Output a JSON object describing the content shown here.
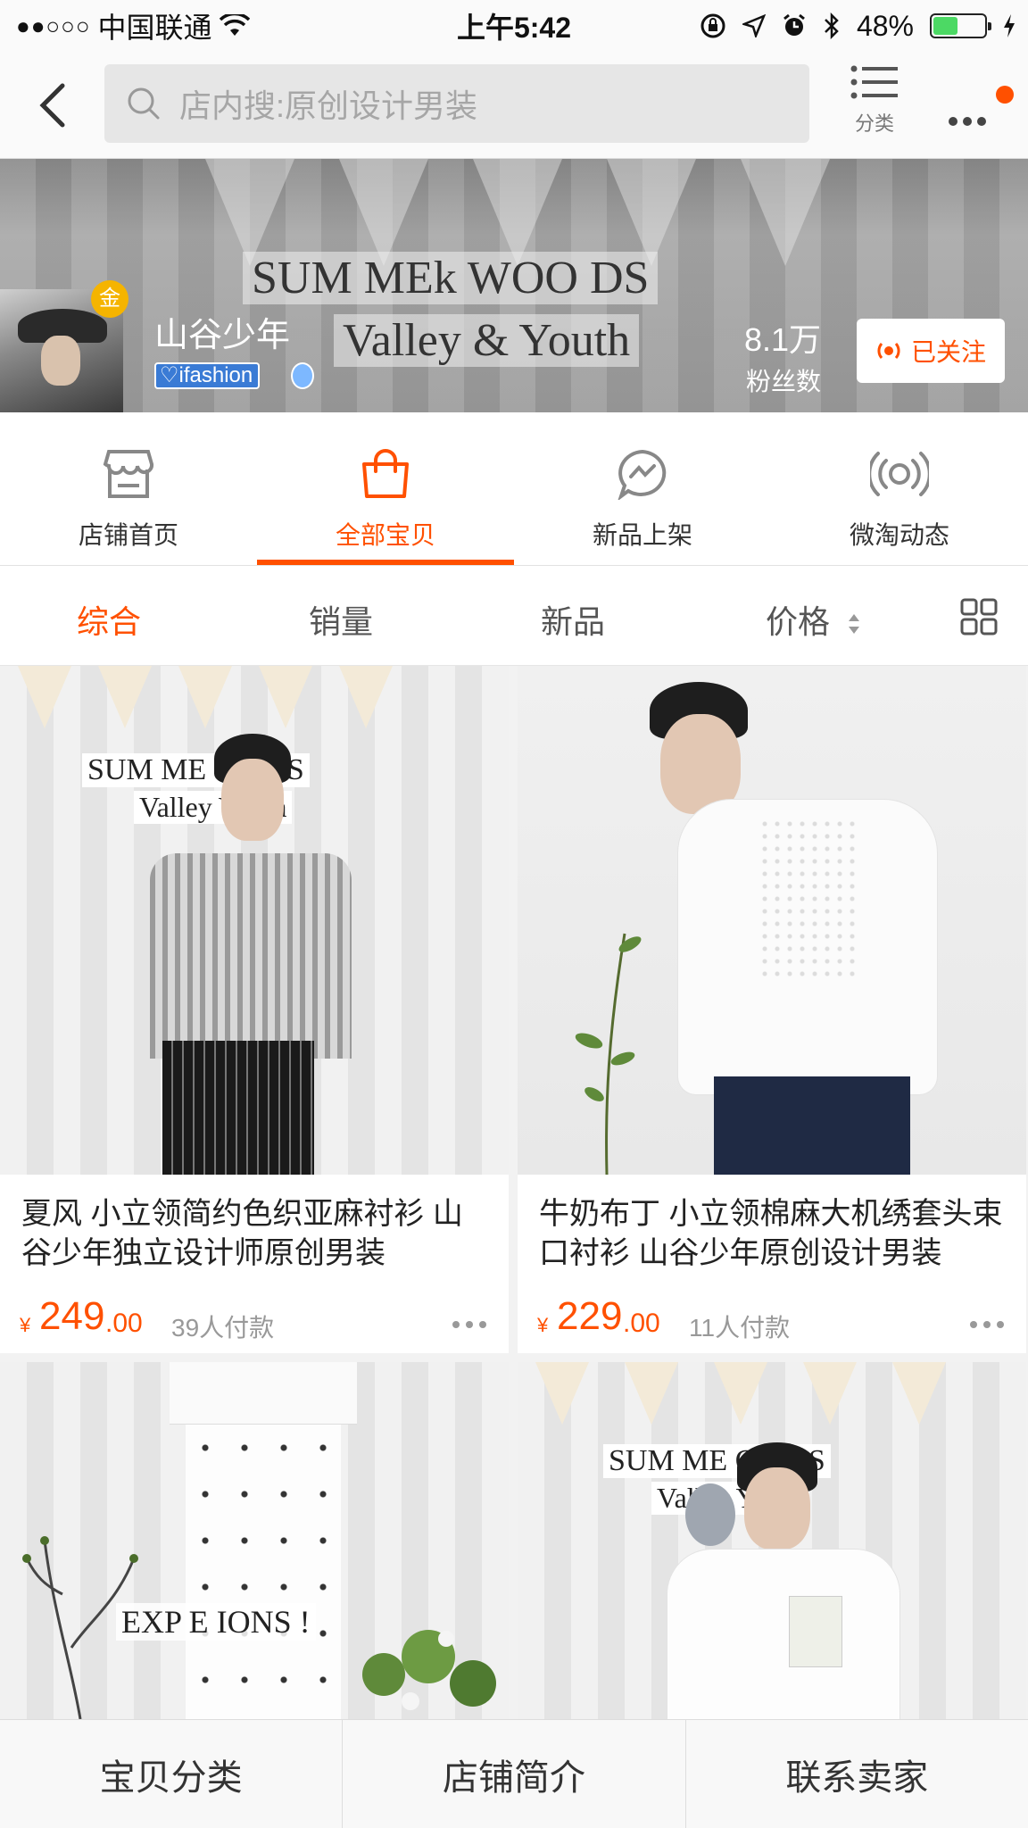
{
  "status_bar": {
    "signal": "●●○○○",
    "carrier": "中国联通",
    "time": "上午5:42",
    "battery": "48%",
    "battery_level": 0.48
  },
  "nav": {
    "search_placeholder": "店内搜:原创设计男装",
    "category_label": "分类"
  },
  "shop": {
    "name": "山谷少年",
    "gold_badge": "金",
    "ifashion_label": "ifashion",
    "fans_count": "8.1万",
    "fans_label": "粉丝数",
    "follow_label": "已关注",
    "banner_line1": "SUM MEk WOO DS",
    "banner_line2": "Valley & Youth"
  },
  "shop_tabs": [
    {
      "label": "店铺首页",
      "icon": "store-icon",
      "active": false
    },
    {
      "label": "全部宝贝",
      "icon": "bag-icon",
      "active": true
    },
    {
      "label": "新品上架",
      "icon": "new-arrival-icon",
      "active": false
    },
    {
      "label": "微淘动态",
      "icon": "broadcast-icon",
      "active": false
    }
  ],
  "sort": {
    "items": [
      "综合",
      "销量",
      "新品",
      "价格"
    ],
    "active": "综合"
  },
  "products": [
    {
      "title": "夏风 小立领简约色织亚麻衬衫 山谷少年独立设计师原创男装",
      "price_yen": "¥",
      "price_int": "249",
      "price_dec": ".00",
      "sold": "39人付款",
      "sign_line1": "SUM ME    OO DS",
      "sign_line2": "Valley        Youth"
    },
    {
      "title": "牛奶布丁 小立领棉麻大机绣套头束口衬衫 山谷少年原创设计男装",
      "price_yen": "¥",
      "price_int": "229",
      "price_dec": ".00",
      "sold": "11人付款"
    },
    {
      "sign_text": "EXP E     IONS !"
    },
    {
      "sign_line1": "SUM ME    OO DS",
      "sign_line2": "Valley        Youth"
    }
  ],
  "bottom_bar": [
    "宝贝分类",
    "店铺简介",
    "联系卖家"
  ],
  "colors": {
    "accent": "#ff5000",
    "price": "#ff5000",
    "battery_green": "#4cd964"
  }
}
